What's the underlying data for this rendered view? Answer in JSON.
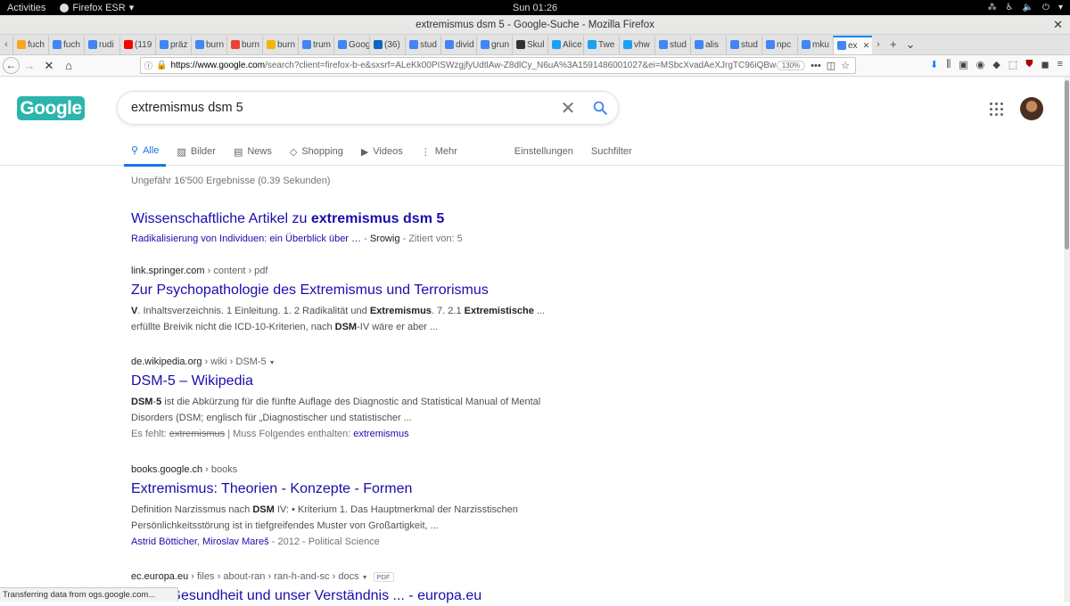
{
  "desktop": {
    "activities": "Activities",
    "app_menu": "Firefox ESR",
    "clock": "Sun 01:26"
  },
  "window": {
    "title": "extremismus dsm 5 - Google-Suche - Mozilla Firefox"
  },
  "tabs": [
    {
      "label": "fuch",
      "fav_color": "#f5a623"
    },
    {
      "label": "fuch",
      "fav_color": "#4285f4"
    },
    {
      "label": "rudi",
      "fav_color": "#4285f4"
    },
    {
      "label": "(119",
      "fav_color": "#ff0000"
    },
    {
      "label": "präz",
      "fav_color": "#4285f4"
    },
    {
      "label": "burn",
      "fav_color": "#4285f4"
    },
    {
      "label": "burn",
      "fav_color": "#ea4335"
    },
    {
      "label": "burn",
      "fav_color": "#f4b400"
    },
    {
      "label": "trum",
      "fav_color": "#4285f4"
    },
    {
      "label": "Goog",
      "fav_color": "#4285f4"
    },
    {
      "label": "(36)",
      "fav_color": "#0a66c2"
    },
    {
      "label": "stud",
      "fav_color": "#4285f4"
    },
    {
      "label": "divid",
      "fav_color": "#4285f4"
    },
    {
      "label": "grun",
      "fav_color": "#4285f4"
    },
    {
      "label": "Skul",
      "fav_color": "#333333"
    },
    {
      "label": "Alice",
      "fav_color": "#1da1f2"
    },
    {
      "label": "Twe",
      "fav_color": "#1da1f2"
    },
    {
      "label": "vhw",
      "fav_color": "#1da1f2"
    },
    {
      "label": "stud",
      "fav_color": "#4285f4"
    },
    {
      "label": "alis",
      "fav_color": "#4285f4"
    },
    {
      "label": "stud",
      "fav_color": "#4285f4"
    },
    {
      "label": "npc",
      "fav_color": "#4285f4"
    },
    {
      "label": "mku",
      "fav_color": "#4285f4"
    },
    {
      "label": "ex",
      "fav_color": "#4285f4",
      "active": true
    }
  ],
  "nav": {
    "url_host": "https://www.google.com",
    "url_rest": "/search?client=firefox-b-e&sxsrf=ALeKk00PISWzgjfyUdtlAw-Z8dlCy_N6uA%3A1591486001027&ei=MSbcXvadAeXJrgTC96iQBw&",
    "zoom": "130%"
  },
  "google": {
    "logo": "Google",
    "query": "extremismus dsm 5",
    "tabs": [
      {
        "label": "Alle",
        "icon": "search-icon",
        "active": true
      },
      {
        "label": "Bilder",
        "icon": "image-icon"
      },
      {
        "label": "News",
        "icon": "news-icon"
      },
      {
        "label": "Shopping",
        "icon": "tag-icon"
      },
      {
        "label": "Videos",
        "icon": "play-icon"
      },
      {
        "label": "Mehr",
        "icon": "more-vert-icon"
      }
    ],
    "settings": "Einstellungen",
    "tools": "Suchfilter",
    "stats": "Ungefähr 16'500 Ergebnisse (0.39 Sekunden)",
    "scholar": {
      "title_prefix": "Wissenschaftliche Artikel zu ",
      "title_bold": "extremismus dsm 5",
      "link": "Radikalisierung von Individuen: ein Überblick über …",
      "sep1": " - ",
      "author": "Srowig",
      "cited": " - Zitiert von: 5"
    },
    "results": [
      {
        "domain": "link.springer.com",
        "path": " › content › pdf",
        "title": "Zur Psychopathologie des Extremismus und Terrorismus",
        "snippet_line1": [
          "V",
          ". Inhaltsverzeichnis. 1 Einleitung. 1. 2 Radikalität und ",
          "Extremismus",
          ". 7. 2.1 ",
          "Extremistische",
          " ..."
        ],
        "snippet_line2": [
          "erfüllte Breivik nicht die ICD-10-Kriterien, nach ",
          "DSM",
          "-IV wäre er aber ..."
        ]
      },
      {
        "domain": "de.wikipedia.org",
        "path": " › wiki › DSM-5",
        "title": "DSM-5 – Wikipedia",
        "snippet_line1": [
          "DSM",
          "-",
          "5",
          " ist die Abkürzung für die fünfte Auflage des Diagnostic and Statistical Manual of Mental"
        ],
        "snippet_line2": [
          "Disorders (DSM; englisch für „Diagnostischer und statistischer ..."
        ],
        "missing_label": "Es fehlt: ",
        "missing_word": "extremismus",
        "must_include": " | Muss Folgendes enthalten: ",
        "must_link": "extremismus"
      },
      {
        "domain": "books.google.ch",
        "path": " › books",
        "title": "Extremismus: Theorien - Konzepte - Formen",
        "snippet_line1": [
          "Definition Narzissmus nach ",
          "DSM",
          " IV: • Kriterium 1. Das Hauptmerkmal der Narzisstischen"
        ],
        "snippet_line2": [
          "Persönlichkeitsstörung ist in tiefgreifendes Muster von Großartigkeit, ..."
        ],
        "author1": "Astrid Bötticher",
        "author_sep": ", ",
        "author2": "Miroslav Mareš",
        "meta": " - 2012 - Political Science"
      },
      {
        "domain": "ec.europa.eu",
        "path": " › files › about-ran › ran-h-and-sc › docs",
        "badge": "PDF",
        "title": "...che Gesundheit und unser Verständnis ... - europa.eu"
      }
    ]
  },
  "status": "Transferring data from ogs.google.com..."
}
